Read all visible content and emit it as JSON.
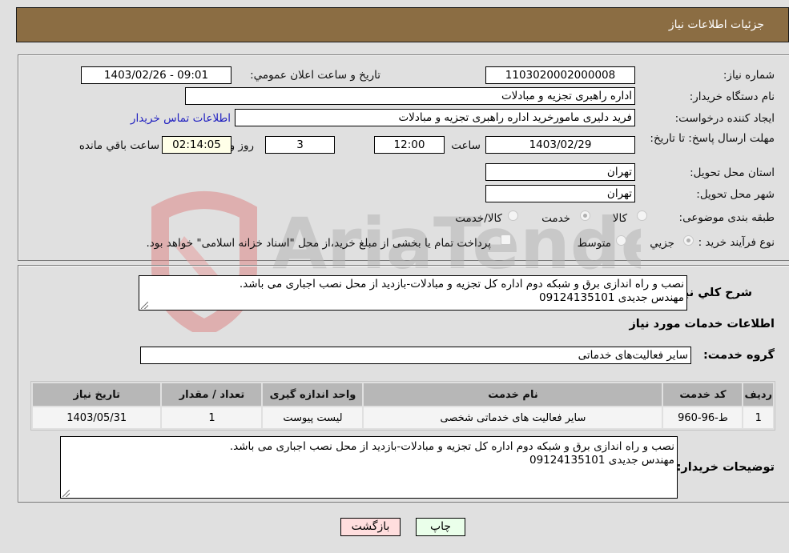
{
  "header": {
    "title": "جزئیات اطلاعات نیاز"
  },
  "need_number": {
    "label": "شماره نیاز:",
    "value": "1103020002000008"
  },
  "announce_datetime": {
    "label": "تاريخ و ساعت اعلان عمومي:",
    "value": "1403/02/26 - 09:01"
  },
  "buyer_org": {
    "label": "نام دستگاه خریدار:",
    "value": "اداره راهبری تجزیه و مبادلات"
  },
  "requester": {
    "label": "ایجاد کننده درخواست:",
    "value": "فرید دلیری مامورخرید اداره راهبری تجزیه و مبادلات",
    "contact_link": "اطلاعات تماس خریدار"
  },
  "deadline": {
    "label": "مهلت ارسال پاسخ: تا تاریخ:",
    "date": "1403/02/29",
    "time_label": "ساعت",
    "time": "12:00",
    "days": "3",
    "days_label": "روز و",
    "remaining": "02:14:05",
    "remaining_label": "ساعت باقي مانده"
  },
  "province": {
    "label": "استان محل تحویل:",
    "value": "تهران"
  },
  "city": {
    "label": "شهر محل تحویل:",
    "value": "تهران"
  },
  "category": {
    "label": "طبقه بندی موضوعی:",
    "options": [
      {
        "label": "کالا",
        "selected": false
      },
      {
        "label": "خدمت",
        "selected": true
      },
      {
        "label": "کالا/خدمت",
        "selected": false
      }
    ]
  },
  "purchase_type": {
    "label": "نوع فرآیند خرید :",
    "options": [
      {
        "label": "جزيي",
        "selected": true
      },
      {
        "label": "متوسط",
        "selected": false
      }
    ],
    "treasury_note": "پرداخت تمام یا بخشی از مبلغ خرید،از محل \"اسناد خزانه اسلامی\" خواهد بود.",
    "treasury_checked": false
  },
  "description": {
    "label": "شرح كلي نياز:",
    "lines": [
      "نصب و راه اندازی برق و شبکه دوم اداره کل تجزیه و مبادلات-بازدید از محل نصب اجباری می باشد.",
      "مهندس جدیدی 09124135101"
    ]
  },
  "services_section": {
    "title": "اطلاعات خدمات مورد نیاز"
  },
  "service_group": {
    "label": "گروه خدمت:",
    "value": "سایر فعالیت‌های خدماتی"
  },
  "table": {
    "headers": [
      "ردیف",
      "کد خدمت",
      "نام خدمت",
      "واحد اندازه گیری",
      "تعداد / مقدار",
      "تاریخ نیاز"
    ],
    "rows": [
      [
        "1",
        "ط-96-960",
        "سایر فعالیت های خدماتی شخصی",
        "لیست پیوست",
        "1",
        "1403/05/31"
      ]
    ]
  },
  "buyer_notes": {
    "label": "توضیحات خریدار:",
    "lines": [
      "نصب و راه اندازی برق و شبکه دوم اداره کل تجزیه و مبادلات-بازدید از محل نصب اجباری می باشد.",
      "مهندس جدیدی 09124135101"
    ]
  },
  "buttons": {
    "print": "چاپ",
    "back": "بازگشت"
  },
  "watermark": {
    "text": "AriaTender.neT"
  },
  "colors": {
    "header_bg": "#8b6d43",
    "print_bg": "#eaffea",
    "back_bg": "#ffdede",
    "link": "#2020c0"
  }
}
